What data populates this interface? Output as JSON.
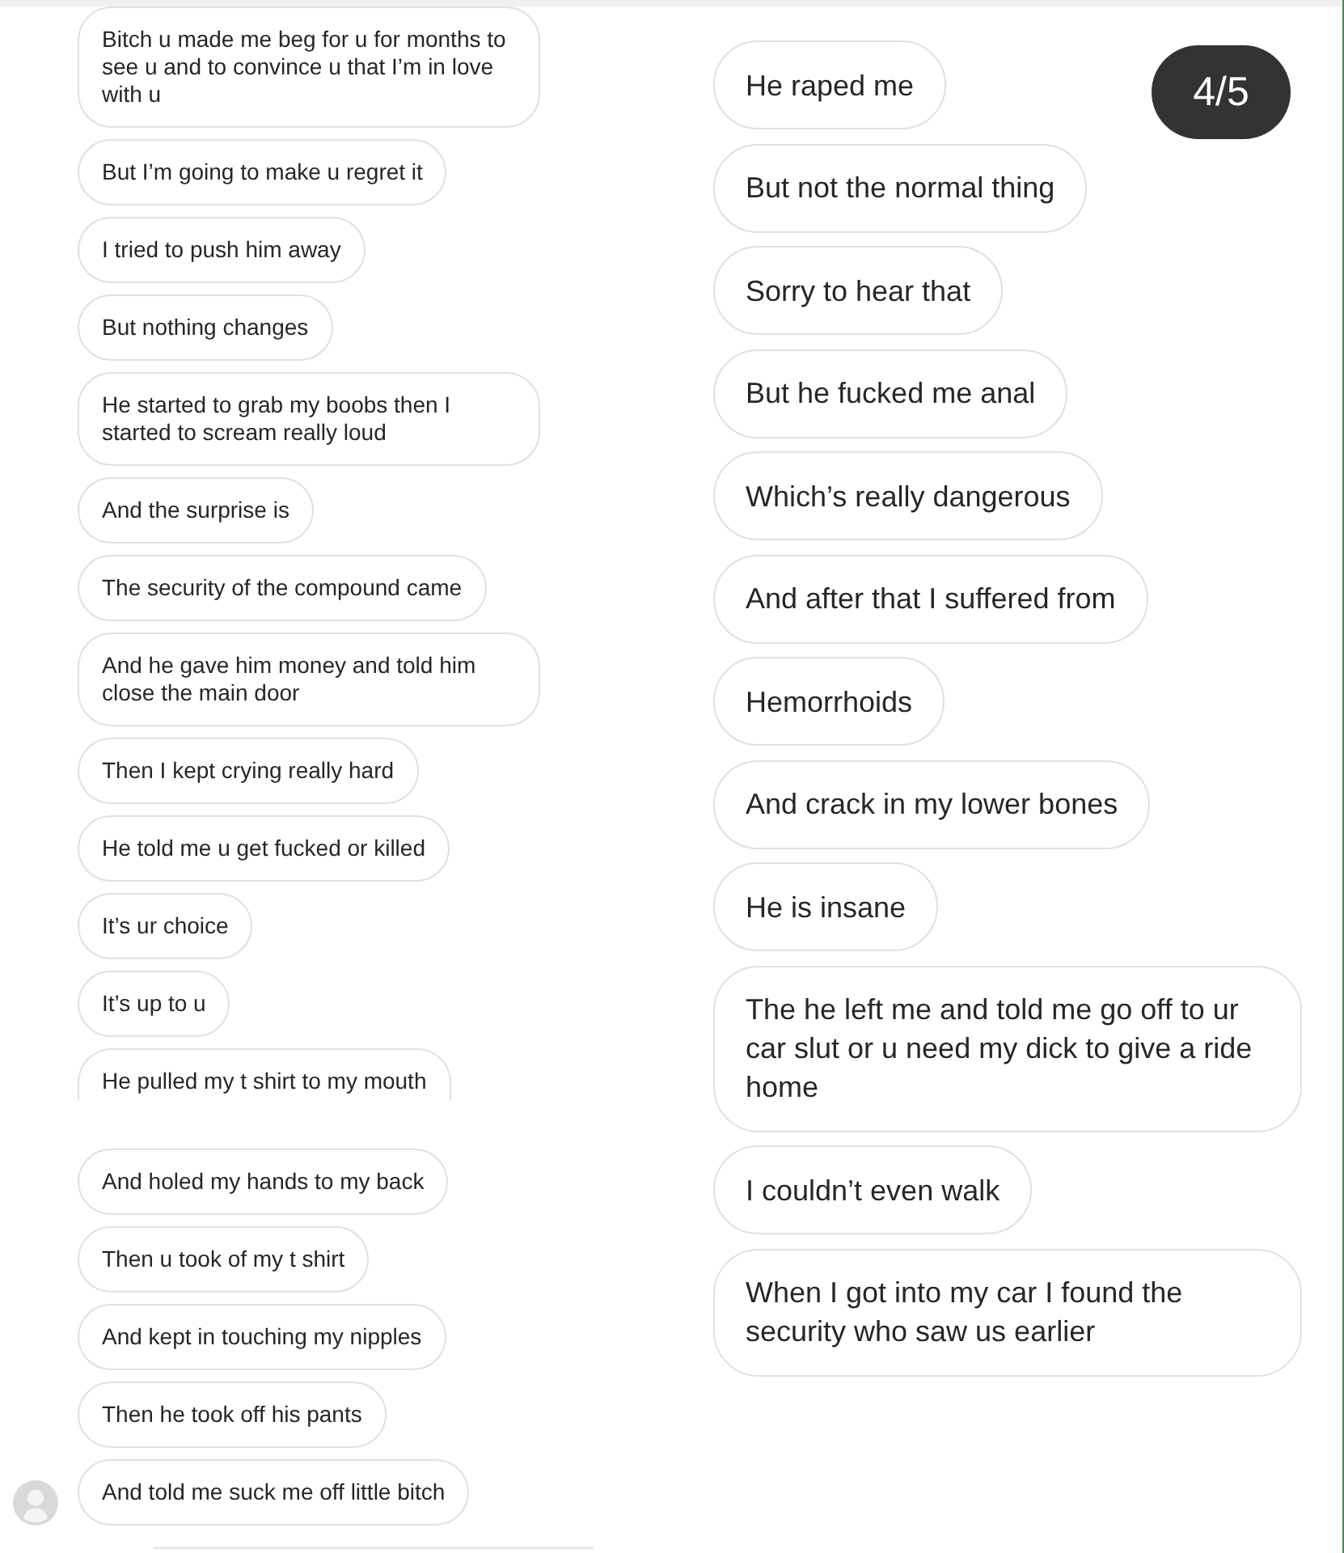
{
  "left_thread": {
    "segments": [
      {
        "cropped": true,
        "messages": [
          "Bitch u made me beg for u for months to see u and to convince u that I’m in love with u",
          "But I’m going to make u regret it",
          "I tried to push him away",
          "But nothing changes",
          "He started to grab my boobs then I started to scream really loud",
          "And the surprise is",
          "The security of the compound came",
          "And he gave him money and told him close the main door",
          "Then I kept crying really hard",
          "He told me u get fucked or killed",
          "It’s ur choice",
          "It’s up to u",
          "He pulled my t shirt to my mouth"
        ]
      },
      {
        "cropped": false,
        "messages": [
          "And holed my hands to my back",
          "Then u took of my t shirt",
          "And kept in touching my nipples",
          "Then he took off his pants",
          "And told me suck me off little bitch"
        ]
      }
    ]
  },
  "right_thread": {
    "page_indicator": "4/5",
    "messages": [
      "He raped me",
      "But not the normal thing",
      "Sorry to hear that",
      "But he fucked me anal",
      "Which’s really dangerous",
      "And after that I suffered from",
      "Hemorrhoids",
      "And crack in my lower bones",
      "He is insane",
      "The he left me and told me go off to ur car slut or u need my dick to give a ride home",
      "I couldn’t even walk",
      "When I got into my car I found the security who saw us earlier"
    ]
  }
}
